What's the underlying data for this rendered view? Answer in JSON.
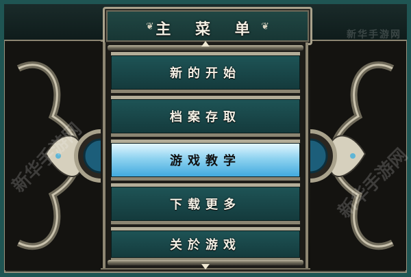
{
  "title": "主 菜 单",
  "title_ornament": "❦",
  "menu": {
    "selected_index": 2,
    "items": [
      {
        "label": "新的开始"
      },
      {
        "label": "档案存取"
      },
      {
        "label": "游戏教学"
      },
      {
        "label": "下载更多"
      },
      {
        "label": "关於游戏"
      }
    ]
  },
  "watermark": "新华手游网",
  "colors": {
    "frame": "#1f5553",
    "button": "#1e5456",
    "selected": "#8fd3f0",
    "metal": "#b3ad98",
    "gem": "#1c5e7a"
  }
}
